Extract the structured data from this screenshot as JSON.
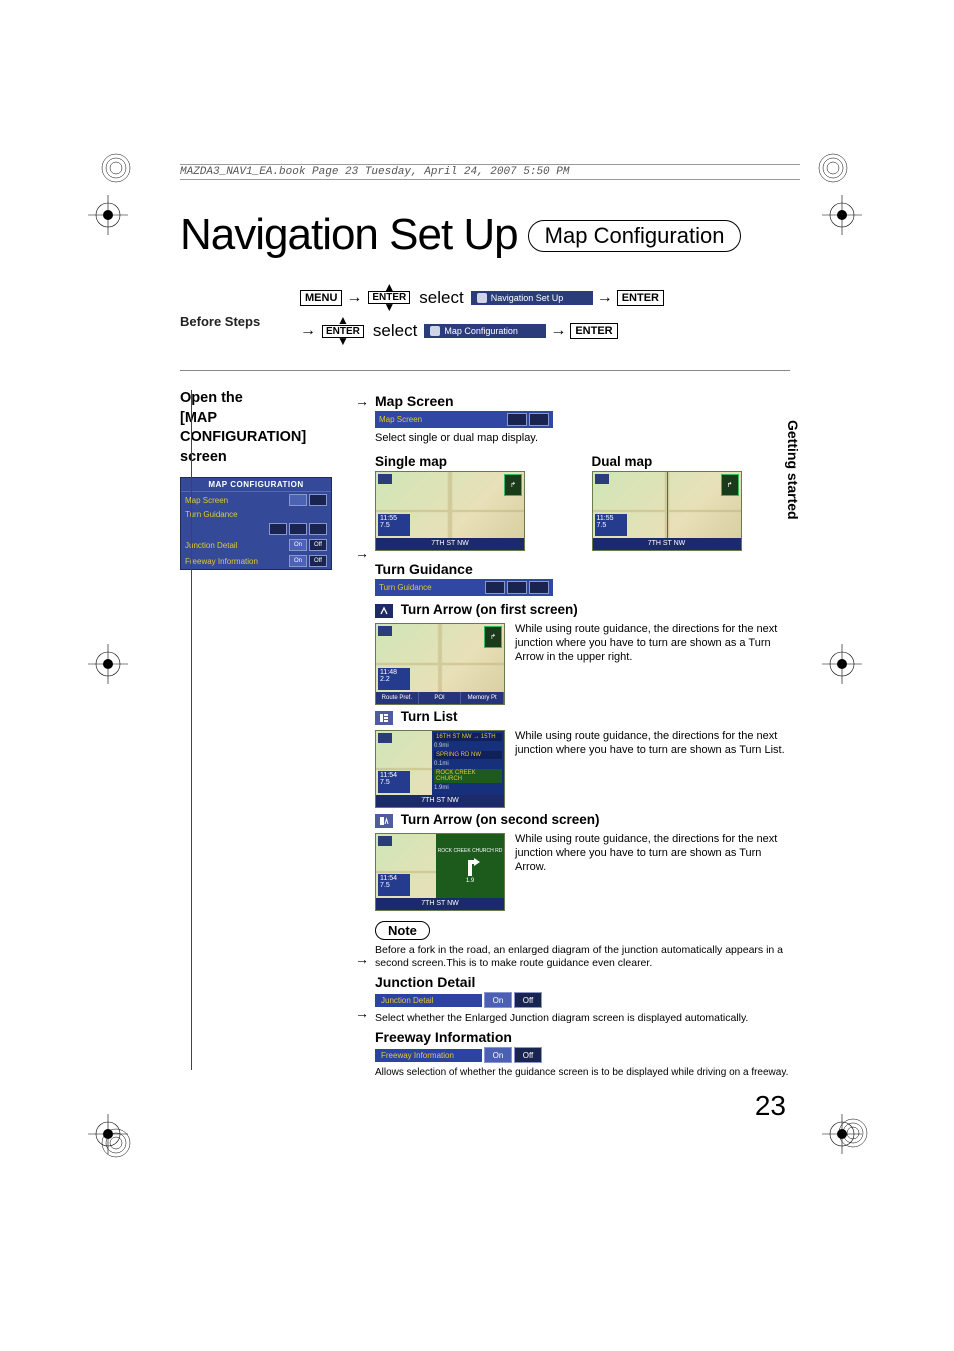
{
  "meta": {
    "header": "MAZDA3_NAV1_EA.book  Page 23  Tuesday, April 24, 2007  5:50 PM"
  },
  "title": {
    "main": "Navigation Set Up",
    "pill": "Map Configuration"
  },
  "before": {
    "label": "Before Steps",
    "menu": "MENU",
    "enter": "ENTER",
    "select": "select",
    "chip1": "Navigation Set Up",
    "chip2": "Map Configuration"
  },
  "left": {
    "heading_line1": "Open the",
    "heading_line2": "[MAP",
    "heading_line3": "CONFIGURATION]",
    "heading_line4": "screen",
    "panel_title": "MAP CONFIGURATION",
    "rows": [
      {
        "label": "Map Screen"
      },
      {
        "label": "Turn Guidance"
      },
      {
        "label": "Junction Detail",
        "on": "On",
        "off": "Off"
      },
      {
        "label": "Freeway Information",
        "on": "On",
        "off": "Off"
      }
    ]
  },
  "map_screen": {
    "h": "Map Screen",
    "bar": "Map Screen",
    "desc": "Select single or dual map display.",
    "single_h": "Single map",
    "dual_h": "Dual map",
    "road": "7TH ST NW",
    "clock_t": "11:55",
    "clock_m": "7.5"
  },
  "turn_guidance": {
    "h": "Turn Guidance",
    "bar": "Turn Guidance",
    "ta1": {
      "h": "Turn Arrow (on first screen)",
      "txt": "While using route guidance, the directions for the next junction where you have to turn are shown as a Turn Arrow in the upper right.",
      "pref1": "Route Pref.",
      "pref2": "POI",
      "pref3": "Memory Pt"
    },
    "tl": {
      "h": "Turn List",
      "txt": "While using route guidance, the directions for the next junction where you have to turn are shown as Turn List.",
      "it1": "16TH ST NW → 15TH",
      "d1": "0.9mi",
      "it2": "SPRING RD NW",
      "d2": "0.1mi",
      "it3": "ROCK CREEK CHURCH",
      "d3": "1.9mi"
    },
    "ta2": {
      "h": "Turn Arrow (on second screen)",
      "txt": "While using route guidance, the directions for the next junction where you have to turn are shown as Turn Arrow.",
      "road": "ROCK CREEK CHURCH RD",
      "dist": "1.9"
    }
  },
  "note": {
    "label": "Note",
    "txt": "Before a fork in the road, an enlarged diagram of the junction automatically appears in a second screen.This is to make route guidance even clearer."
  },
  "jd": {
    "h": "Junction Detail",
    "bar": "Junction Detail",
    "on": "On",
    "off": "Off",
    "txt": "Select whether the Enlarged Junction diagram screen is displayed automatically."
  },
  "fi": {
    "h": "Freeway Information",
    "bar": "Freeway Information",
    "on": "On",
    "off": "Off",
    "txt": "Allows selection of whether the guidance screen is to be displayed while driving on a freeway."
  },
  "side_tab": "Getting started",
  "page_num": "23"
}
